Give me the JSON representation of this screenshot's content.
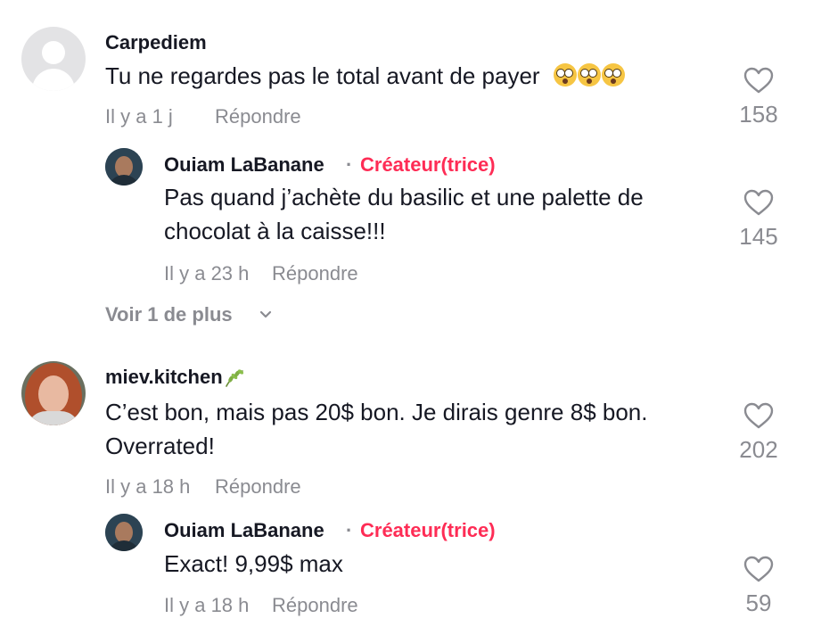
{
  "comments": [
    {
      "username": "Carpediem",
      "text": "Tu ne regardes pas le total avant de payer",
      "emojis": [
        "flushed-face",
        "flushed-face",
        "flushed-face"
      ],
      "time": "Il y a 1 j",
      "reply_label": "Répondre",
      "likes": "158",
      "replies": [
        {
          "username": "Ouiam LaBanane",
          "separator": "·",
          "creator_label": "Créateur(trice)",
          "text": "Pas quand j’achète du basilic et une palette de chocolat à la caisse!!!",
          "time": "Il y a 23 h",
          "reply_label": "Répondre",
          "likes": "145"
        }
      ],
      "view_more": "Voir 1 de plus"
    },
    {
      "username": "miev.kitchen",
      "username_icon": "herb-leaf-icon",
      "text": "C’est bon, mais pas 20$ bon. Je dirais genre 8$ bon. Overrated!",
      "time": "Il y a 18 h",
      "reply_label": "Répondre",
      "likes": "202",
      "replies": [
        {
          "username": "Ouiam LaBanane",
          "separator": "·",
          "creator_label": "Créateur(trice)",
          "text": "Exact! 9,99$ max",
          "time": "Il y a 18 h",
          "reply_label": "Répondre",
          "likes": "59"
        }
      ]
    }
  ],
  "icons": {
    "like": "heart-outline-icon",
    "expand": "chevron-down-icon"
  },
  "colors": {
    "text_primary": "#161823",
    "text_secondary": "#8a8b91",
    "creator_accent": "#fe2c55",
    "background": "#ffffff"
  }
}
